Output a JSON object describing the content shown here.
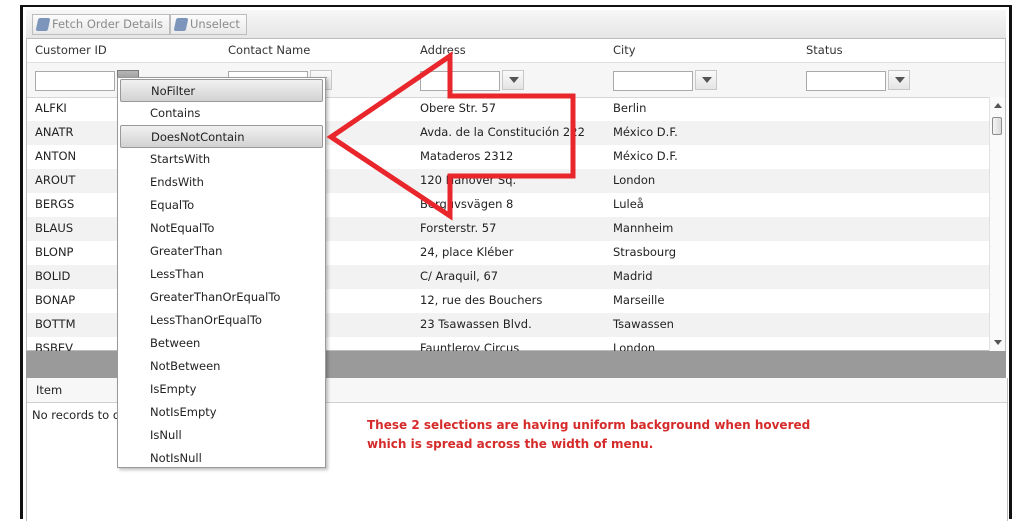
{
  "toolbar": {
    "fetch_label": "Fetch Order Details",
    "unselect_label": "Unselect"
  },
  "columns": [
    "Customer ID",
    "Contact Name",
    "Address",
    "City",
    "Status"
  ],
  "rows": [
    {
      "id": "ALFKI",
      "address": "Obere Str. 57",
      "city": "Berlin"
    },
    {
      "id": "ANATR",
      "address": "Avda. de la Constitución 222",
      "city": "México D.F."
    },
    {
      "id": "ANTON",
      "address": "Mataderos 2312",
      "city": "México D.F."
    },
    {
      "id": "AROUT",
      "address": "120 Hanover Sq.",
      "city": "London"
    },
    {
      "id": "BERGS",
      "address": "Berguvsvägen 8",
      "city": "Luleå"
    },
    {
      "id": "BLAUS",
      "address": "Forsterstr. 57",
      "city": "Mannheim"
    },
    {
      "id": "BLONP",
      "address": "24, place Kléber",
      "city": "Strasbourg"
    },
    {
      "id": "BOLID",
      "address": "C/ Araquil, 67",
      "city": "Madrid"
    },
    {
      "id": "BONAP",
      "address": "12, rue des Bouchers",
      "city": "Marseille"
    },
    {
      "id": "BOTTM",
      "address": "23 Tsawassen Blvd.",
      "city": "Tsawassen"
    },
    {
      "id": "BSBEV",
      "address": "Fauntleroy Circus",
      "city": "London"
    }
  ],
  "detail": {
    "column": "Item",
    "empty_text": "No records to display."
  },
  "filter_menu": {
    "items": [
      "NoFilter",
      "Contains",
      "DoesNotContain",
      "StartsWith",
      "EndsWith",
      "EqualTo",
      "NotEqualTo",
      "GreaterThan",
      "LessThan",
      "GreaterThanOrEqualTo",
      "LessThanOrEqualTo",
      "Between",
      "NotBetween",
      "IsEmpty",
      "NotIsEmpty",
      "IsNull",
      "NotIsNull"
    ],
    "highlighted": [
      "NoFilter",
      "DoesNotContain"
    ]
  },
  "annotation": {
    "line1": "These 2 selections are having uniform background when hovered",
    "line2": "which is spread across the width of menu.",
    "color": "#d62b2b"
  }
}
